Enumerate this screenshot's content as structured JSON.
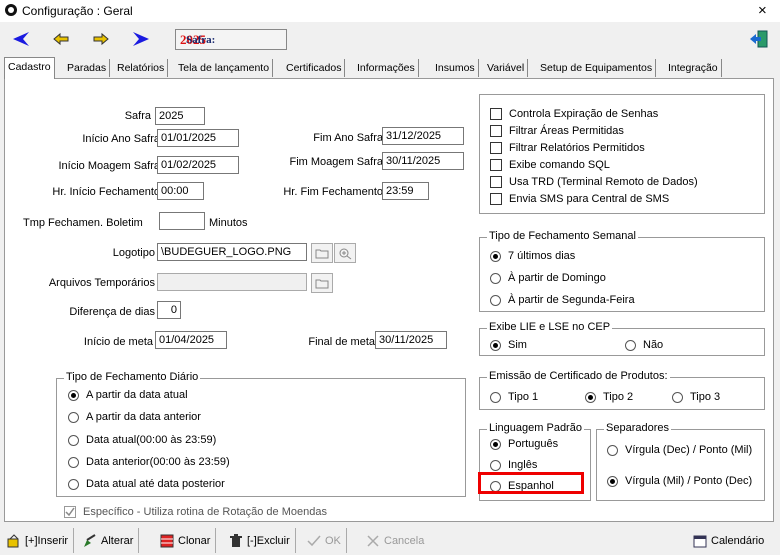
{
  "window": {
    "title": "Configuração : Geral",
    "close": "×"
  },
  "toolbar": {
    "safra_label": "Safra:",
    "safra_value": "2025"
  },
  "tabs": [
    "Cadastro",
    "Paradas",
    "Relatórios",
    "Tela de lançamento",
    "Certificados",
    "Informações",
    "Insumos",
    "Variável",
    "Setup de Equipamentos",
    "Integração"
  ],
  "form": {
    "safra": {
      "label": "Safra",
      "value": "2025"
    },
    "inicio_ano": {
      "label": "Início Ano Safra",
      "value": "01/01/2025"
    },
    "fim_ano": {
      "label": "Fim Ano Safra",
      "value": "31/12/2025"
    },
    "inicio_moagem": {
      "label": "Início Moagem Safra",
      "value": "01/02/2025"
    },
    "fim_moagem": {
      "label": "Fim Moagem Safra",
      "value": "30/11/2025"
    },
    "hr_inicio": {
      "label": "Hr. Início Fechamento",
      "value": "00:00"
    },
    "hr_fim": {
      "label": "Hr. Fim Fechamento",
      "value": "23:59"
    },
    "tmp": {
      "label": "Tmp Fechamen. Boletim",
      "value": "",
      "unit": "Minutos"
    },
    "logotipo": {
      "label": "Logotipo",
      "value": "\\BUDEGUER_LOGO.PNG"
    },
    "arquivos": {
      "label": "Arquivos Temporários",
      "value": ""
    },
    "diferenca": {
      "label": "Diferença de dias",
      "value": "0"
    },
    "inicio_meta": {
      "label": "Início de meta",
      "value": "01/04/2025"
    },
    "final_meta": {
      "label": "Final de meta",
      "value": "30/11/2025"
    }
  },
  "fech_diario": {
    "title": "Tipo de Fechamento Diário",
    "options": [
      "A partir da data atual",
      "A partir da data anterior",
      "Data atual(00:00 às 23:59)",
      "Data anterior(00:00 às 23:59)",
      "Data atual até data posterior"
    ]
  },
  "especifico": "Específico - Utiliza rotina de Rotação de Moendas",
  "checks": [
    "Controla Expiração de Senhas",
    "Filtrar Áreas Permitidas",
    "Filtrar Relatórios Permitidos",
    "Exibe comando SQL",
    "Usa TRD (Terminal Remoto de Dados)",
    "Envia SMS para Central de SMS"
  ],
  "fech_semanal": {
    "title": "Tipo de Fechamento Semanal",
    "options": [
      "7 últimos dias",
      "À partir de Domingo",
      "À partir de Segunda-Feira"
    ]
  },
  "lie": {
    "title": "Exibe LIE e LSE no CEP",
    "options": [
      "Sim",
      "Não"
    ]
  },
  "certificado": {
    "title": "Emissão de Certificado de Produtos:",
    "options": [
      "Tipo 1",
      "Tipo 2",
      "Tipo 3"
    ]
  },
  "linguagem": {
    "title": "Linguagem Padrão",
    "options": [
      "Português",
      "Inglês",
      "Espanhol"
    ]
  },
  "separadores": {
    "title": "Separadores",
    "options": [
      "Vírgula (Dec) / Ponto (Mil)",
      "Vírgula (Mil) / Ponto (Dec)"
    ]
  },
  "bottom": {
    "inserir": "[+]Inserir",
    "alterar": "Alterar",
    "clonar": "Clonar",
    "excluir": "[-]Excluir",
    "ok": "OK",
    "cancela": "Cancela",
    "calendario": "Calendário"
  }
}
